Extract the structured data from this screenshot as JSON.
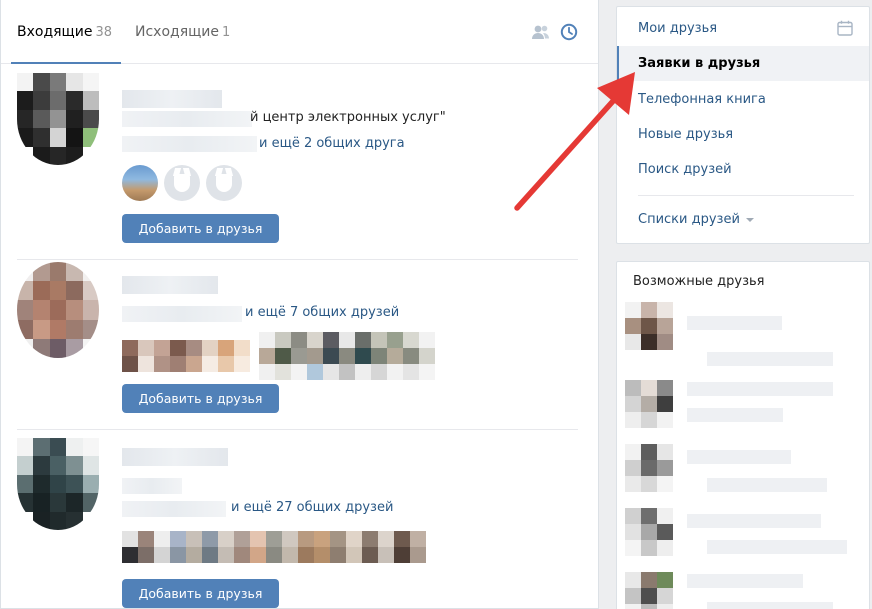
{
  "tabs": {
    "incoming_label": "Входящие",
    "incoming_count": "38",
    "outgoing_label": "Исходящие",
    "outgoing_count": "1"
  },
  "requests": [
    {
      "subtitle": "й центр электронных услуг\"",
      "mutual": "и ещё 2 общих друга",
      "button": "Добавить в друзья"
    },
    {
      "mutual": "и ещё 7 общих друзей",
      "button": "Добавить в друзья"
    },
    {
      "mutual": "и ещё 27 общих друзей",
      "button": "Добавить в друзья"
    }
  ],
  "menu": {
    "items": [
      {
        "label": "Мои друзья"
      },
      {
        "label": "Заявки в друзья"
      },
      {
        "label": "Телефонная книга"
      },
      {
        "label": "Новые друзья"
      },
      {
        "label": "Поиск друзей"
      }
    ],
    "lists_label": "Списки друзей"
  },
  "possible_friends": {
    "title": "Возможные друзья"
  },
  "colors": {
    "accent": "#5181b8",
    "link": "#2a5885",
    "arrow": "#e53935"
  },
  "icons": [
    "friends-icon",
    "clock-icon",
    "calendar-icon",
    "chevron-down-icon",
    "arrow-annotation"
  ]
}
